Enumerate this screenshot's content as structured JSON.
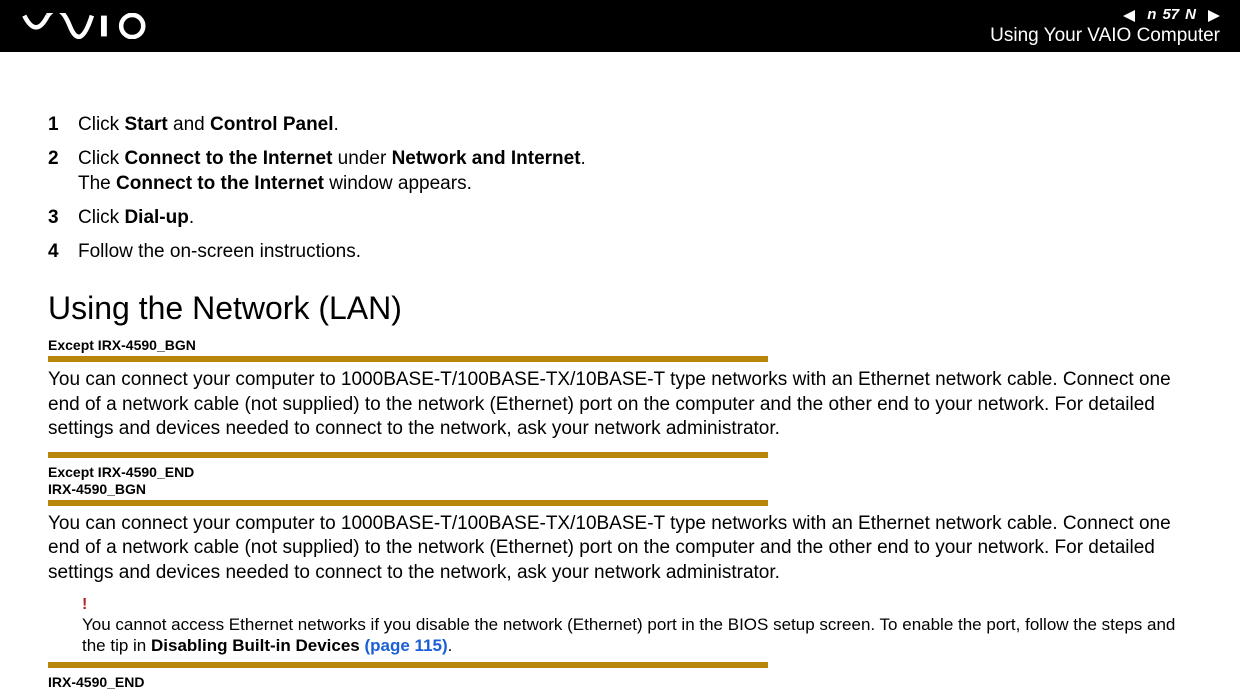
{
  "header": {
    "page_number": "57",
    "n_letter": "n",
    "N_letter": "N",
    "subtitle": "Using Your VAIO Computer"
  },
  "steps": [
    {
      "num": "1",
      "pre": "Click ",
      "b1": "Start",
      "mid": " and ",
      "b2": "Control Panel",
      "post": "."
    },
    {
      "num": "2",
      "pre": "Click ",
      "b1": "Connect to the Internet",
      "mid": " under ",
      "b2": "Network and Internet",
      "post": ".",
      "line2_pre": "The ",
      "line2_b": "Connect to the Internet",
      "line2_post": " window appears."
    },
    {
      "num": "3",
      "pre": "Click ",
      "b1": "Dial-up",
      "post": "."
    },
    {
      "num": "4",
      "pre": "Follow the on-screen instructions."
    }
  ],
  "section_heading": "Using the Network (LAN)",
  "tags": {
    "except_bgn": "Except IRX-4590_BGN",
    "except_end": "Except IRX-4590_END",
    "irx_bgn": "IRX-4590_BGN",
    "irx_end": "IRX-4590_END"
  },
  "lan_paragraph": "You can connect your computer to 1000BASE-T/100BASE-TX/10BASE-T type networks with an Ethernet network cable. Connect one end of a network cable (not supplied) to the network (Ethernet) port on the computer and the other end to your network. For detailed settings and devices needed to connect to the network, ask your network administrator.",
  "note": {
    "bang": "!",
    "text_pre": "You cannot access Ethernet networks if you disable the network (Ethernet) port in the BIOS setup screen. To enable the port, follow the steps and the tip in ",
    "text_b": "Disabling Built-in Devices ",
    "text_link": "(page 115)",
    "text_post": "."
  }
}
